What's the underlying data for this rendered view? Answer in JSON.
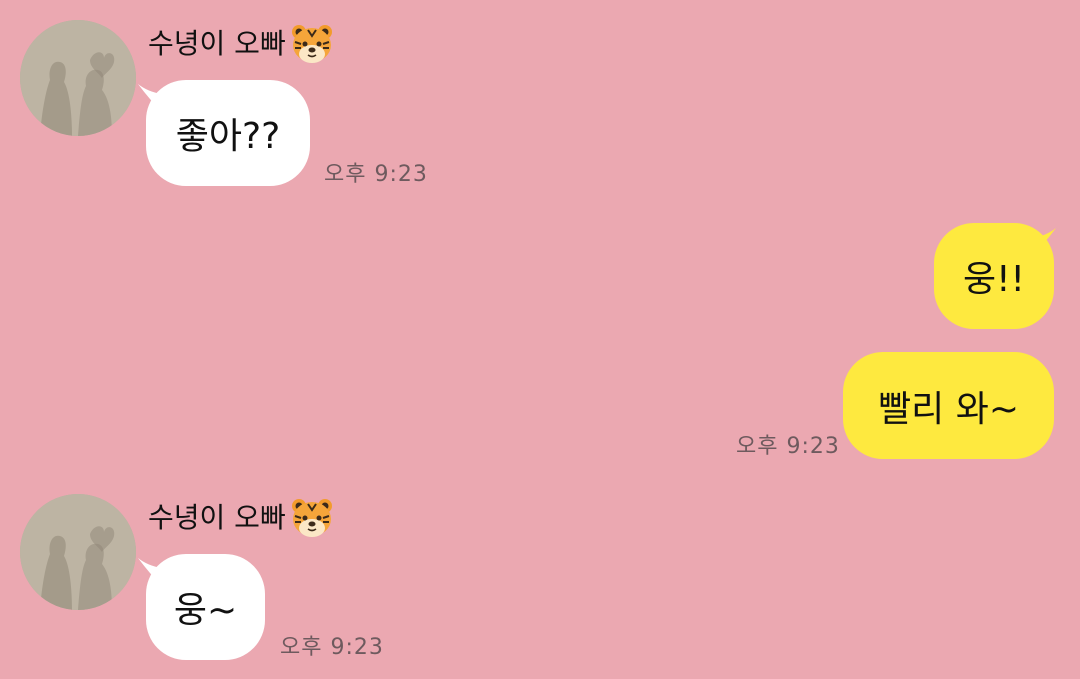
{
  "messages": [
    {
      "direction": "incoming",
      "sender": "수녕이 오빠",
      "sender_emoji": "tiger-face-icon",
      "text": "좋아??",
      "time": "오후 9:23"
    },
    {
      "direction": "outgoing",
      "text": "웅!!",
      "time": ""
    },
    {
      "direction": "outgoing",
      "text": "빨리 와~",
      "time": "오후 9:23"
    },
    {
      "direction": "incoming",
      "sender": "수녕이 오빠",
      "sender_emoji": "tiger-face-icon",
      "text": "웅~",
      "time": "오후 9:23"
    }
  ],
  "colors": {
    "background": "#eba8b1",
    "incoming_bubble": "#ffffff",
    "outgoing_bubble": "#fee93f",
    "timestamp": "#6e5a5e"
  }
}
